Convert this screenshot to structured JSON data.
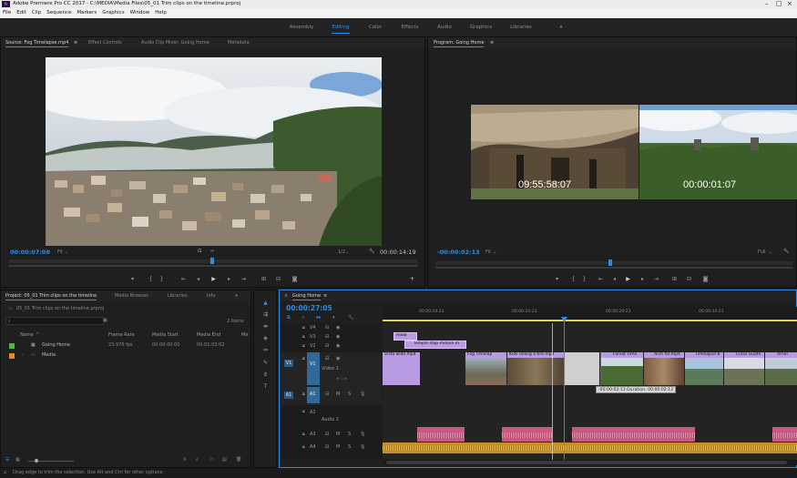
{
  "app": {
    "title": "Adobe Premiere Pro CC 2017 - C:\\MEDIA\\Media Files\\05_01 Trim clips on the timeline.prproj",
    "icon_label": "Pr"
  },
  "menu": [
    "File",
    "Edit",
    "Clip",
    "Sequence",
    "Markers",
    "Graphics",
    "Window",
    "Help"
  ],
  "workspaces": {
    "items": [
      "Assembly",
      "Editing",
      "Color",
      "Effects",
      "Audio",
      "Graphics",
      "Libraries"
    ],
    "active": "Editing",
    "more": "»"
  },
  "source_panel": {
    "tabs": [
      "Source: Fog Timelapse.mp4",
      "Effect Controls",
      "Audio Clip Mixer: Going Home",
      "Metadata"
    ],
    "menu_icon": "≡",
    "timecode_in": "00:00:07:08",
    "fit_label": "Fit",
    "ratio": "1/2",
    "timecode_duration": "00:00:14:19"
  },
  "program_panel": {
    "tab": "Program: Going Home",
    "menu_icon": "≡",
    "left_timecode": "09:55:58:07",
    "right_timecode": "00:00:01:07",
    "timecode_in": "-00:00:02:13",
    "fit_label": "Fit",
    "full_label": "Full"
  },
  "project_panel": {
    "tabs": [
      "Project: 05_01 Trim clips on the timeline",
      "Media Browser",
      "Libraries",
      "Info"
    ],
    "project_file": "05_01 Trim clips on the timeline.prproj",
    "items_count": "2 Items",
    "columns": [
      "Name",
      "Frame Rate",
      "Media Start",
      "Media End",
      "Me"
    ],
    "rows": [
      {
        "name": "Going Home",
        "frame_rate": "23.976 fps",
        "media_start": "00:00:00:00",
        "media_end": "00:01:03:02"
      },
      {
        "name": "Media",
        "frame_rate": "",
        "media_start": "",
        "media_end": ""
      }
    ]
  },
  "timeline": {
    "tab": "Going Home",
    "menu_icon": "≡",
    "timecode": "00:00:27:05",
    "ruler": [
      "00:00:19:23",
      "00:00:24:23",
      "00:00:29:23",
      "00:00:34:23"
    ],
    "tracks": {
      "v4": "V4",
      "v3": "V3",
      "v2": "V2",
      "v1": "V1",
      "video1": "Video 1",
      "a1": "A1",
      "a2": "A2",
      "audio2": "Audio 2",
      "a3": "A3",
      "a4": "A4",
      "target": "V1",
      "source_a": "A1"
    },
    "video_clips": [
      {
        "name": "Vista wide.mp4",
        "color": "#b99be3"
      },
      {
        "name": "Fog Timelap",
        "color": "#b99be3"
      },
      {
        "name": "Kids rolling a tire.mp4",
        "color": "#b99be3"
      },
      {
        "name": "Forest Time",
        "color": "#b99be3"
      },
      {
        "name": "Arch far.mp4",
        "color": "#b99be3"
      },
      {
        "name": "Timelapse B",
        "color": "#b99be3"
      },
      {
        "name": "Cross Guate",
        "color": "#b99be3"
      },
      {
        "name": "Arnel",
        "color": "#b99be3"
      }
    ],
    "v3_clip": "Adob",
    "v2_clip": "Temple stop motion.m",
    "tooltip": "-00:00:02:13 Duration: 00:00:02:12",
    "colors": {
      "video": "#b99be3",
      "audio": "#c9577f",
      "music": "#d9a83c",
      "playhead": "#2d8ceb"
    }
  },
  "status": "Drag edge to trim the selection. Use Alt and Ctrl for other options."
}
